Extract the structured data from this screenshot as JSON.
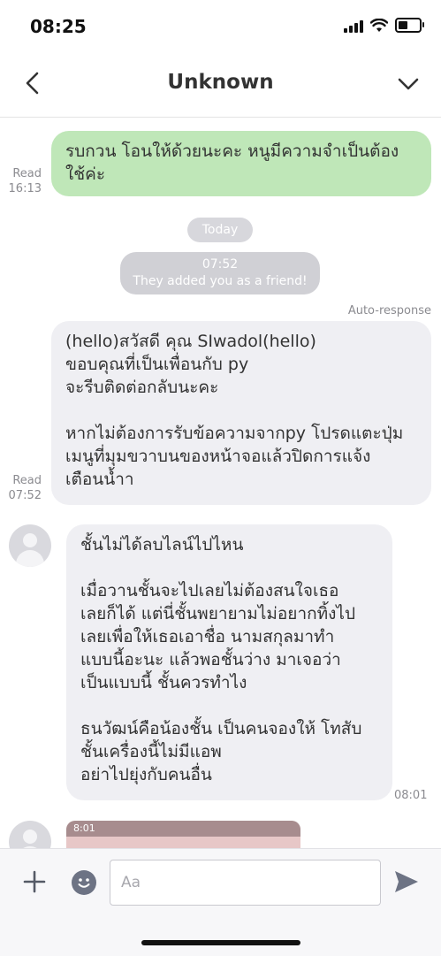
{
  "status_bar": {
    "time": "08:25"
  },
  "header": {
    "title": "Unknown"
  },
  "messages": [
    {
      "id": "m1",
      "text": "รบกวน โอนให้ด้วยนะคะ หนูมีความจำเป็นต้อง\nใช้ค่ะ",
      "read_label": "Read",
      "time": "16:13"
    },
    {
      "id": "m2",
      "text": "(hello)สวัสดี คุณ SIwadol(hello)\nขอบคุณที่เป็นเพื่อนกับ py\nจะรีบติดต่อกลับนะคะ\n\nหากไม่ต้องการรับข้อความจากpy โปรดแตะปุ่ม\nเมนูที่มุมขวาบนของหน้าจอแล้วปิดการแจ้ง\nเตือนน้ำา",
      "read_label": "Read",
      "time": "07:52",
      "tag": "Auto-response"
    },
    {
      "id": "m3",
      "text": "ชั้นไม่ได้ลบไลน์ไปไหน\n\nเมื่อวานชั้นจะไปเลยไม่ต้องสนใจเธอ\nเลยก็ได้ แต่นี่ชั้นพยายามไม่อยากทิ้งไป\nเลยเพื่อให้เธอเอาชื่อ นามสกุลมาทำ\nแบบนี้อะนะ แล้วพอชั้นว่าง มาเจอว่า\nเป็นแบบนี้ ชั้นควรทำไง\n\nธนวัฒน์คือน้องชั้น เป็นคนจองให้ โทสับ\nชั้นเครื่องนี้ไม่มีแอพ\nอย่าไปยุ่งกับคนอื่น",
      "time": "08:01"
    }
  ],
  "date_separator": "Today",
  "system_notice": {
    "time": "07:52",
    "text": "They added you as a friend!"
  },
  "image_preview": {
    "status_time": "8:01"
  },
  "composer": {
    "placeholder": "Aa"
  }
}
